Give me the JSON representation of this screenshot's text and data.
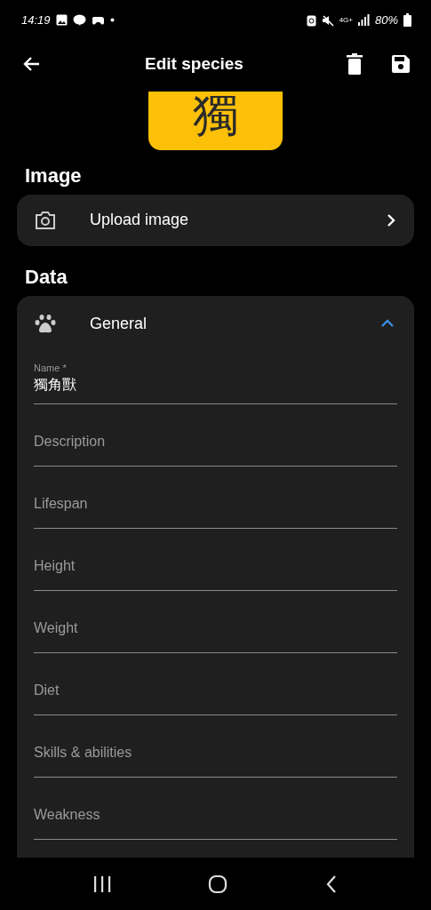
{
  "status_bar": {
    "time": "14:19",
    "network": "4G+",
    "battery": "80%"
  },
  "app_bar": {
    "title": "Edit species"
  },
  "preview": {
    "glyph": "獨"
  },
  "image_section": {
    "heading": "Image",
    "action": "Upload image"
  },
  "data_section": {
    "heading": "Data",
    "group": {
      "title": "General",
      "expanded": true,
      "fields": [
        {
          "label": "Name *",
          "value": "獨角獸"
        },
        {
          "placeholder": "Description"
        },
        {
          "placeholder": "Lifespan"
        },
        {
          "placeholder": "Height"
        },
        {
          "placeholder": "Weight"
        },
        {
          "placeholder": "Diet"
        },
        {
          "placeholder": "Skills & abilities"
        },
        {
          "placeholder": "Weakness"
        }
      ]
    }
  }
}
